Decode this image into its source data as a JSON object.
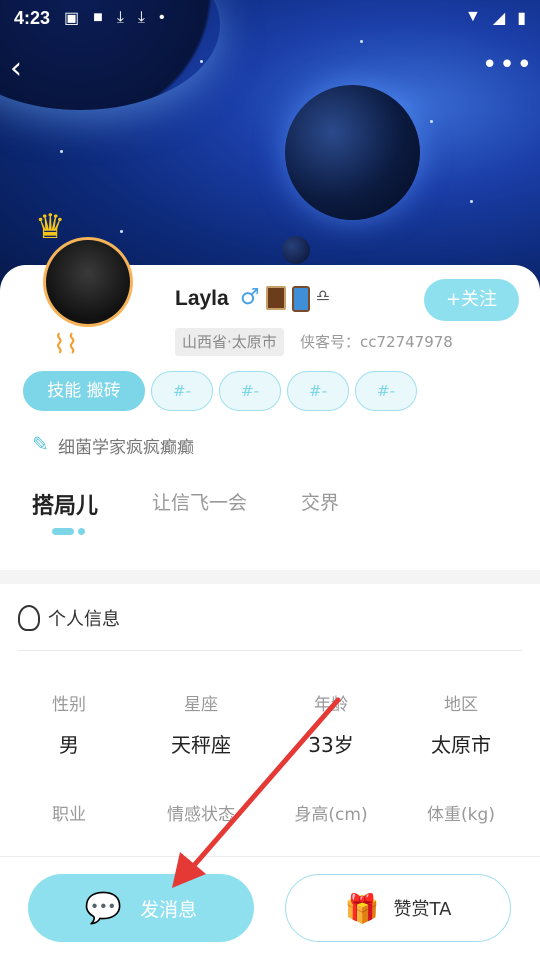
{
  "status_bar": {
    "time": "4:23",
    "left_icons": [
      "image-icon",
      "square-icon",
      "download-icon",
      "download-icon",
      "dot-icon"
    ],
    "right_icons": [
      "wifi-icon",
      "signal-icon",
      "battery-icon"
    ]
  },
  "header": {
    "back_icon": "‹",
    "more_icon": "•••"
  },
  "profile": {
    "username": "Layla",
    "gender_symbol": "♂",
    "follow_label": "+关注",
    "location": "山西省·太原市",
    "xk_id": "侠客号：cc72747978",
    "skill_tag": "技能 搬砖",
    "empty_tags": [
      "#-",
      "#-",
      "#-",
      "#-"
    ],
    "signature": "细菌学家疯疯癫癫"
  },
  "tabs": [
    "搭局儿",
    "让信飞一会",
    "交界"
  ],
  "info": {
    "title": "个人信息",
    "row1": [
      {
        "label": "性别",
        "value": "男"
      },
      {
        "label": "星座",
        "value": "天秤座"
      },
      {
        "label": "年龄",
        "value": "33岁"
      },
      {
        "label": "地区",
        "value": "太原市"
      }
    ],
    "row2": [
      {
        "label": "职业"
      },
      {
        "label": "情感状态"
      },
      {
        "label": "身高(cm)"
      },
      {
        "label": "体重(kg)"
      }
    ]
  },
  "bottom": {
    "message_label": "发消息",
    "reward_label": "赞赏TA"
  },
  "colors": {
    "accent": "#8fe0ef",
    "accent_dark": "#7dd5e8",
    "arrow": "#e53935"
  }
}
